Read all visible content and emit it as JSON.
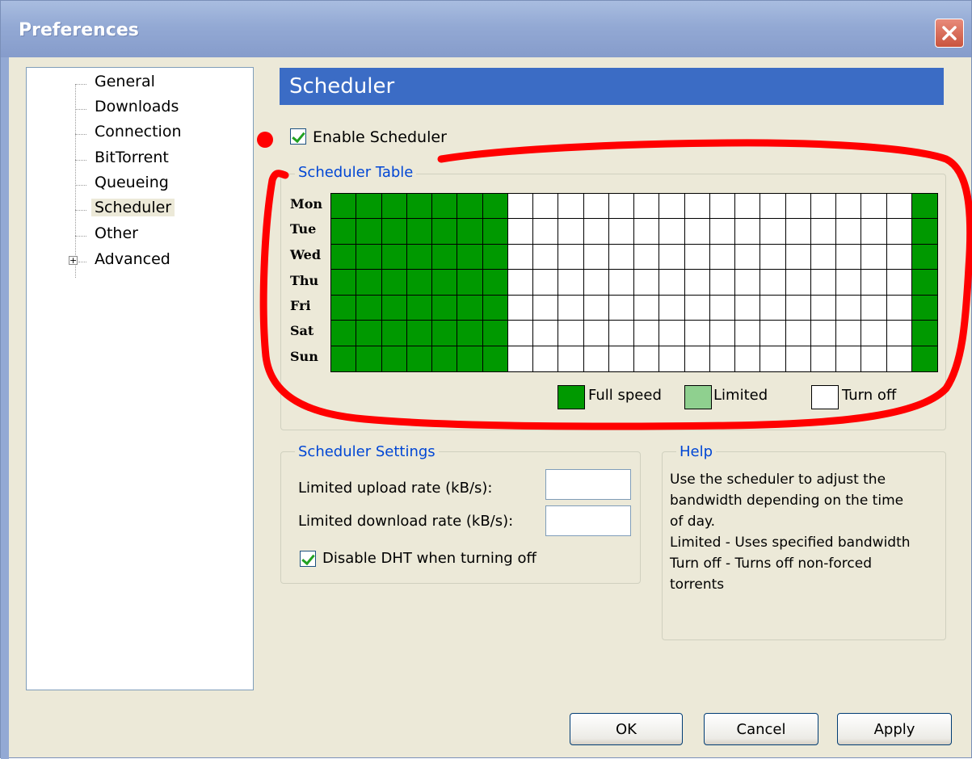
{
  "window": {
    "title": "Preferences",
    "close_glyph": "✕"
  },
  "sidebar": {
    "items": [
      {
        "label": "General"
      },
      {
        "label": "Downloads"
      },
      {
        "label": "Connection"
      },
      {
        "label": "BitTorrent"
      },
      {
        "label": "Queueing"
      },
      {
        "label": "Scheduler",
        "selected": true
      },
      {
        "label": "Other"
      },
      {
        "label": "Advanced",
        "expandable": true,
        "expander_glyph": "+"
      }
    ]
  },
  "header": {
    "title": "Scheduler"
  },
  "enable_scheduler": {
    "label": "Enable Scheduler",
    "checked": true
  },
  "scheduler_table": {
    "title": "Scheduler Table",
    "days": [
      "Mon",
      "Tue",
      "Wed",
      "Thu",
      "Fri",
      "Sat",
      "Sun"
    ],
    "hours": 24,
    "full_speed_hours": [
      0,
      1,
      2,
      3,
      4,
      5,
      6,
      23
    ],
    "legend": [
      {
        "label": "Full speed",
        "color": "#009900"
      },
      {
        "label": "Limited",
        "color": "#8fd08f"
      },
      {
        "label": "Turn off",
        "color": "#ffffff"
      }
    ]
  },
  "scheduler_settings": {
    "title": "Scheduler Settings",
    "upload_label": "Limited upload rate (kB/s):",
    "upload_value": "",
    "download_label": "Limited download rate (kB/s):",
    "download_value": "",
    "disable_dht_label": "Disable DHT when turning off",
    "disable_dht_checked": true
  },
  "help": {
    "title": "Help",
    "text": "Use the scheduler to adjust the\nbandwidth depending on the time\nof day.\nLimited - Uses specified bandwidth\nTurn off - Turns off non-forced\ntorrents"
  },
  "buttons": {
    "ok": "OK",
    "cancel": "Cancel",
    "apply": "Apply"
  },
  "colors": {
    "full_speed": "#009900",
    "limited": "#8fd08f",
    "turn_off": "#ffffff",
    "annotation_red": "#ff0000",
    "header_blue": "#3b6cc5"
  }
}
